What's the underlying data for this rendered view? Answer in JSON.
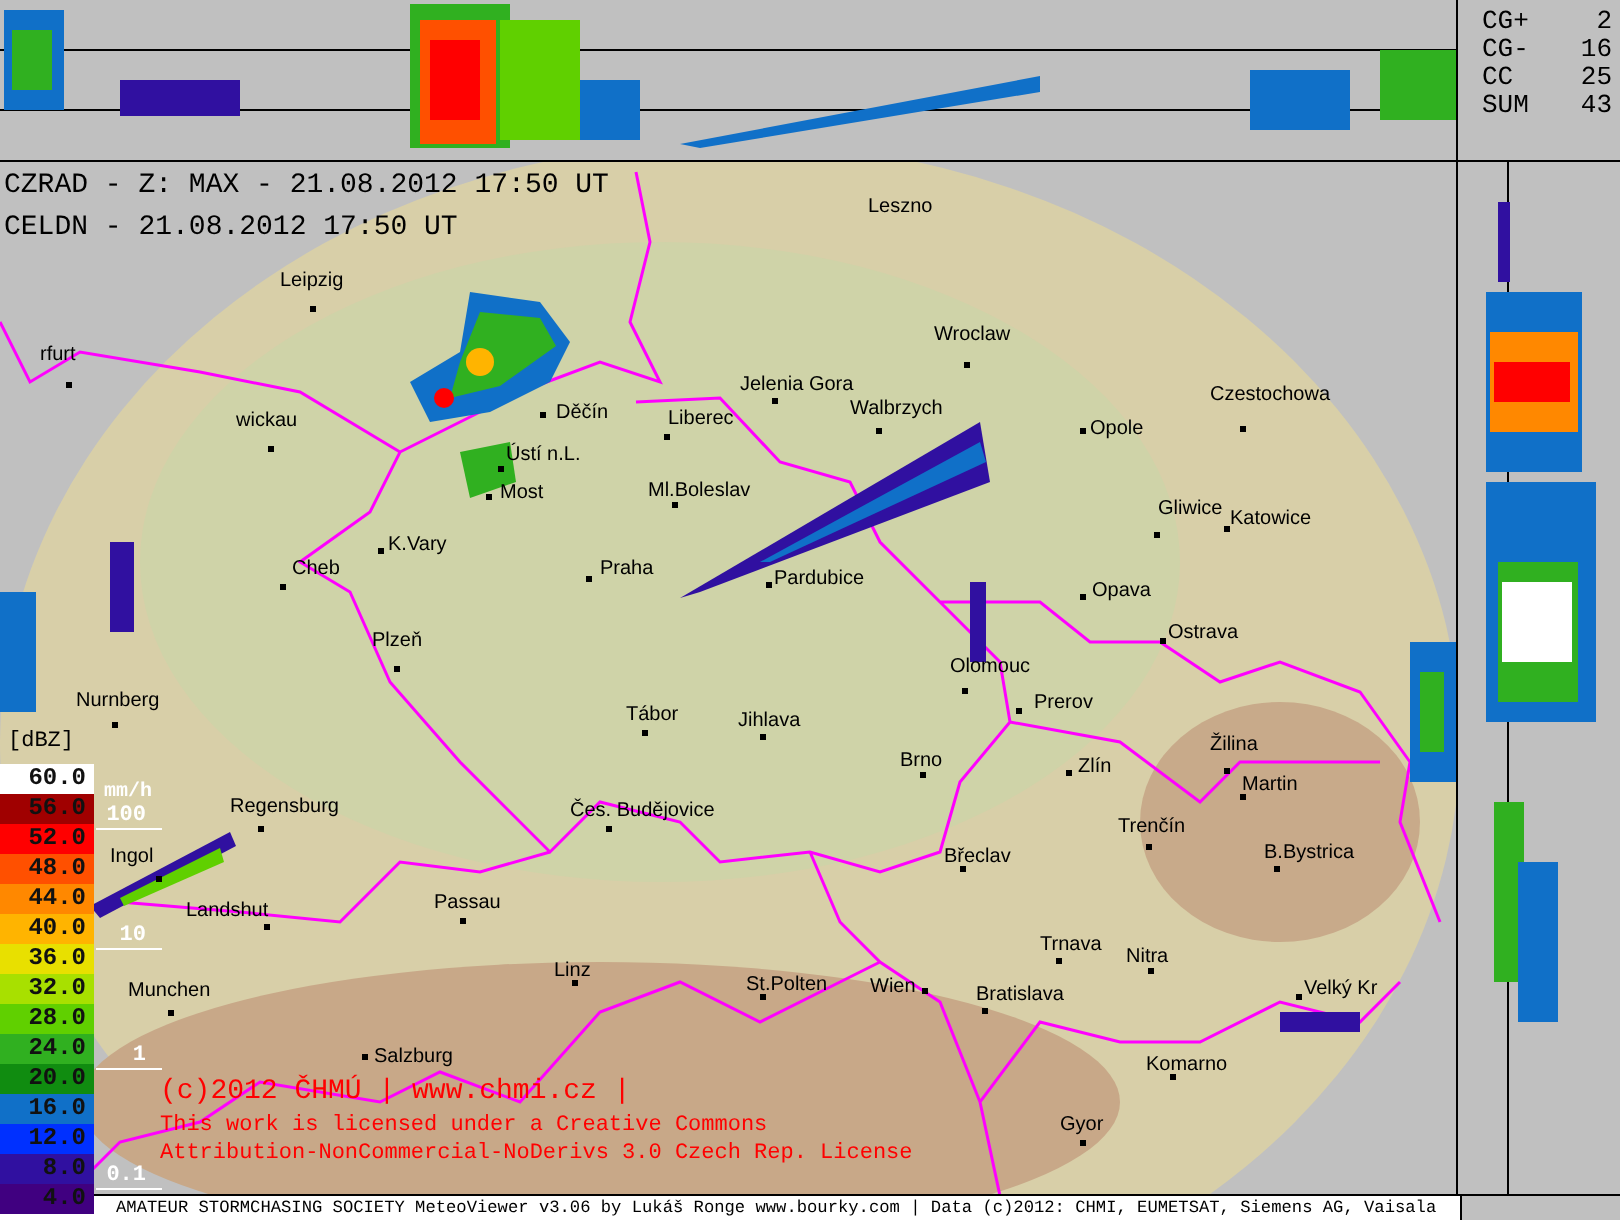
{
  "header": {
    "lines": [
      "CZRAD - Z: MAX - 21.08.2012 17:50 UT",
      "CELDN - 21.08.2012 17:50 UT"
    ]
  },
  "lightning_stats": [
    {
      "label": "CG+",
      "value": "2"
    },
    {
      "label": "CG-",
      "value": "16"
    },
    {
      "label": "CC",
      "value": "25"
    },
    {
      "label": "SUM",
      "value": "43"
    }
  ],
  "map": {
    "cities": [
      {
        "name": "Leszno"
      },
      {
        "name": "Leipzig"
      },
      {
        "name": "rfurt"
      },
      {
        "name": "Wroclaw"
      },
      {
        "name": "Czestochowa"
      },
      {
        "name": "wickau"
      },
      {
        "name": "Jelenia Gora"
      },
      {
        "name": "Děčín"
      },
      {
        "name": "Liberec"
      },
      {
        "name": "Walbrzych"
      },
      {
        "name": "Opole"
      },
      {
        "name": "Ústí n.L."
      },
      {
        "name": "Most"
      },
      {
        "name": "Ml.Boleslav"
      },
      {
        "name": "Gliwice"
      },
      {
        "name": "Katowice"
      },
      {
        "name": "K.Vary"
      },
      {
        "name": "Praha"
      },
      {
        "name": "Cheb"
      },
      {
        "name": "Pardubice"
      },
      {
        "name": "Opava"
      },
      {
        "name": "Ostrava"
      },
      {
        "name": "Plzeň"
      },
      {
        "name": "Olomouc"
      },
      {
        "name": "Nurnberg"
      },
      {
        "name": "Prerov"
      },
      {
        "name": "Tábor"
      },
      {
        "name": "Jihlava"
      },
      {
        "name": "Brno"
      },
      {
        "name": "Zlín"
      },
      {
        "name": "Žilina"
      },
      {
        "name": "Martin"
      },
      {
        "name": "Regensburg"
      },
      {
        "name": "Čes. Budějovice"
      },
      {
        "name": "Trenčín"
      },
      {
        "name": "Ingol"
      },
      {
        "name": "Břeclav"
      },
      {
        "name": "B.Bystrica"
      },
      {
        "name": "Landshut"
      },
      {
        "name": "Passau"
      },
      {
        "name": "Trnava"
      },
      {
        "name": "Nitra"
      },
      {
        "name": "Munchen"
      },
      {
        "name": "Linz"
      },
      {
        "name": "St.Polten"
      },
      {
        "name": "Wien"
      },
      {
        "name": "Bratislava"
      },
      {
        "name": "Velký Kr"
      },
      {
        "name": "Salzburg"
      },
      {
        "name": "Komarno"
      },
      {
        "name": "Gyor"
      }
    ]
  },
  "legend": {
    "unit": "[dBZ]",
    "rain_unit": "mm/h",
    "rain_marks": [
      "100",
      "10",
      "1",
      "0.1"
    ],
    "steps": [
      {
        "value": "60.0",
        "color": "#ffffff"
      },
      {
        "value": "56.0",
        "color": "#a00000"
      },
      {
        "value": "52.0",
        "color": "#ff0000"
      },
      {
        "value": "48.0",
        "color": "#ff5000"
      },
      {
        "value": "44.0",
        "color": "#ff8800"
      },
      {
        "value": "40.0",
        "color": "#ffb400"
      },
      {
        "value": "36.0",
        "color": "#e8e000"
      },
      {
        "value": "32.0",
        "color": "#a8e000"
      },
      {
        "value": "28.0",
        "color": "#60d000"
      },
      {
        "value": "24.0",
        "color": "#30b020"
      },
      {
        "value": "20.0",
        "color": "#108c10"
      },
      {
        "value": "16.0",
        "color": "#1070c8"
      },
      {
        "value": "12.0",
        "color": "#0030ff"
      },
      {
        "value": "8.0",
        "color": "#3010a0"
      },
      {
        "value": "4.0",
        "color": "#400080"
      }
    ]
  },
  "copyright": {
    "lines": [
      "(c)2012 ČHMÚ | www.chmi.cz |",
      "This work is licensed under a Creative Commons",
      "Attribution-NonCommercial-NoDerivs 3.0 Czech Rep. License"
    ]
  },
  "footer": {
    "text": "AMATEUR STORMCHASING SOCIETY MeteoViewer v3.06 by Lukáš Ronge www.bourky.com | Data (c)2012: CHMI, EUMETSAT, Siemens AG, Vaisala"
  }
}
